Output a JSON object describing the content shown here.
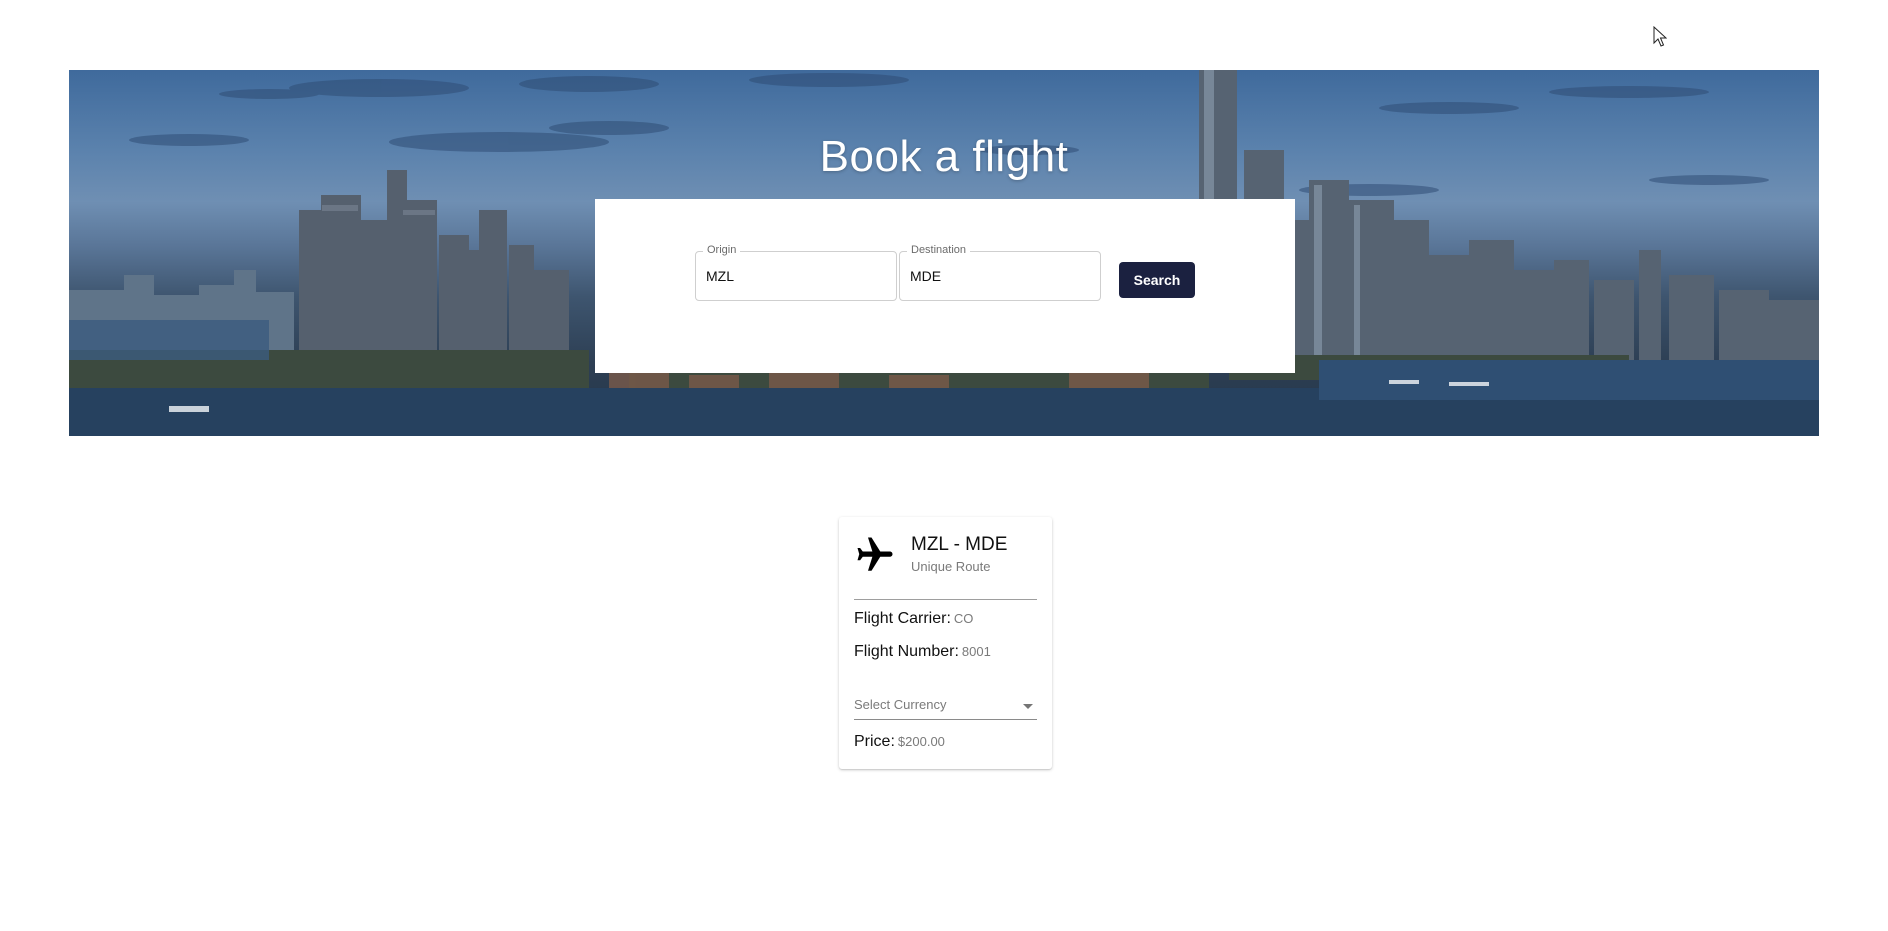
{
  "hero": {
    "title": "Book a flight"
  },
  "search": {
    "origin_label": "Origin",
    "origin_value": "MZL",
    "destination_label": "Destination",
    "destination_value": "MDE",
    "button_label": "Search"
  },
  "result_card": {
    "icon": "airplane-icon",
    "route": "MZL - MDE",
    "subtitle": "Unique Route",
    "carrier_label": "Flight Carrier:",
    "carrier_value": "CO",
    "number_label": "Flight Number:",
    "number_value": "8001",
    "currency_placeholder": "Select Currency",
    "price_label": "Price:",
    "price_value": "$200.00"
  },
  "colors": {
    "button_bg": "#1b2140",
    "button_text": "#ffffff",
    "muted_text": "#7a7a7a"
  }
}
